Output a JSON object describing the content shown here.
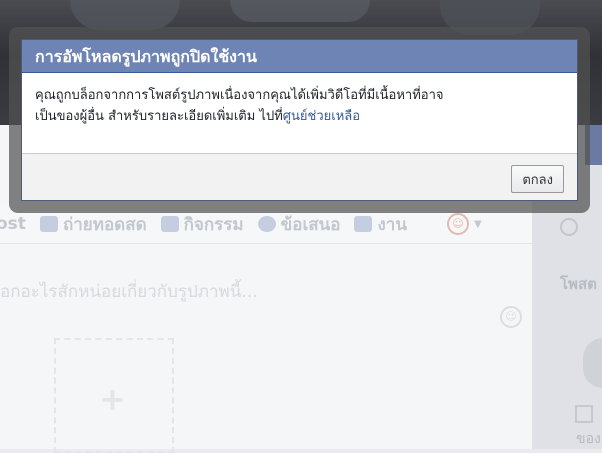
{
  "dialog": {
    "title": "การอัพโหลดรูปภาพถูกปิดใช้งาน",
    "message_line1": "คุณถูกบล็อกจากการโพสต์รูปภาพเนื่องจากคุณได้เพิ่มวิดีโอที่มีเนื้อหาที่อาจ",
    "message_line2_prefix": "เป็นของผู้อื่น สำหรับรายละเอียดเพิ่มเติม ไปที่",
    "help_link": "ศูนย์ช่วยเหลือ",
    "ok_label": "ตกลง"
  },
  "background": {
    "tabs": [
      {
        "label": "ost",
        "icon": ""
      },
      {
        "label": "ถ่ายทอดสด",
        "icon": "video-icon"
      },
      {
        "label": "กิจกรรม",
        "icon": "calendar-icon"
      },
      {
        "label": "ข้อเสนอ",
        "icon": "offer-icon"
      },
      {
        "label": "งาน",
        "icon": "briefcase-icon"
      }
    ],
    "composer_placeholder": "อกอะไรสักหน่อยเกี่ยวกับรูปภาพนี้...",
    "right_heading": "โพสต",
    "right_text": "ของ"
  },
  "colors": {
    "dialog_header": "#6d84b4",
    "link": "#365899",
    "overlay_frame": "#525252"
  }
}
